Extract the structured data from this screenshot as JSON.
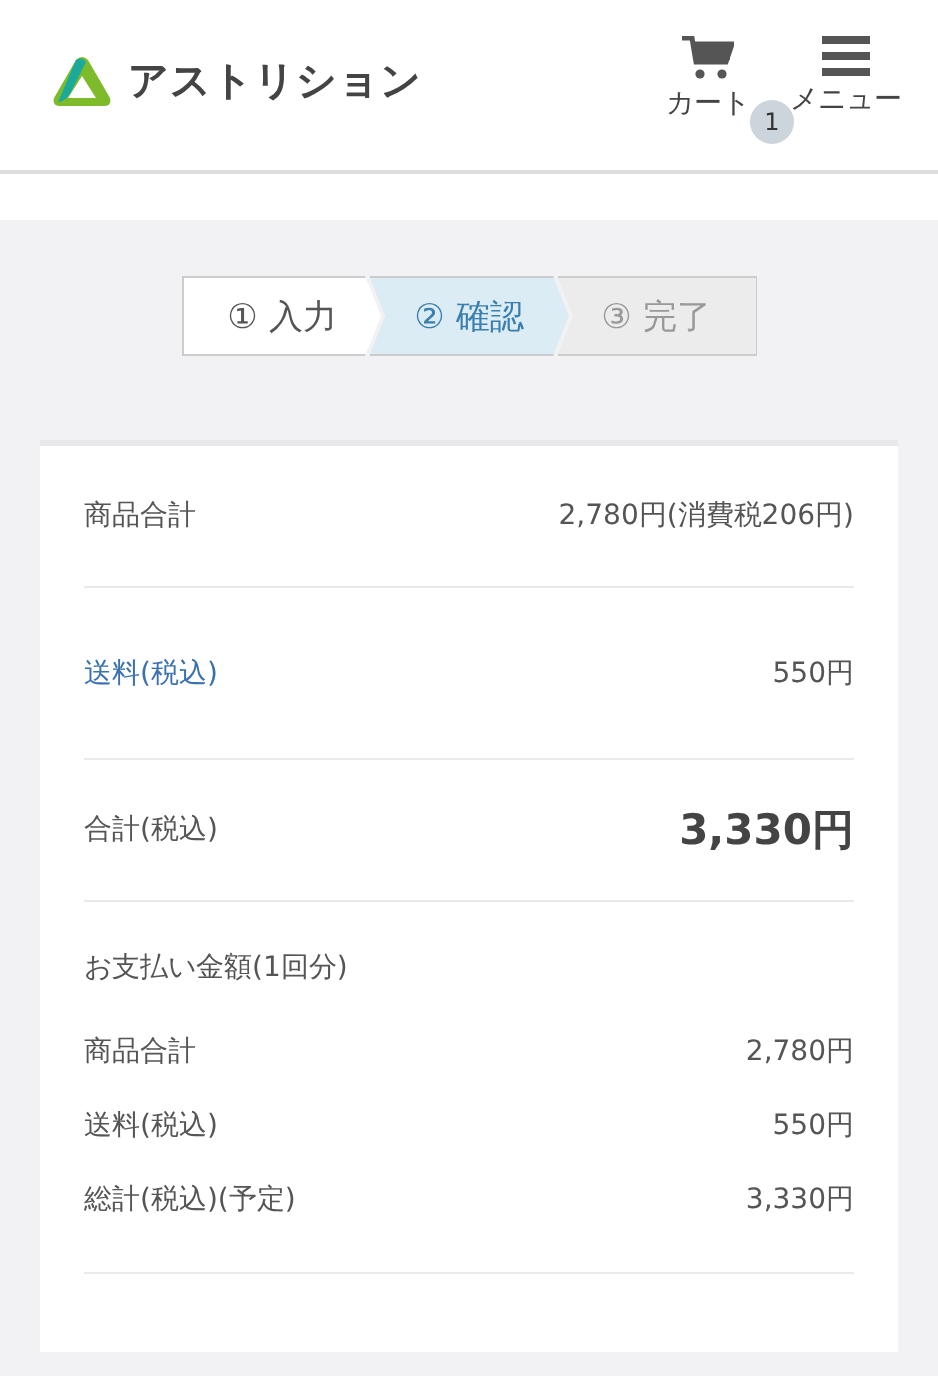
{
  "header": {
    "logo_text": "アストリション",
    "cart": {
      "label": "カート",
      "count": "1"
    },
    "menu": {
      "label": "メニュー"
    }
  },
  "steps": [
    {
      "label": "① 入力",
      "selected": false,
      "completed": true
    },
    {
      "label": "② 確認",
      "selected": true,
      "completed": false
    },
    {
      "label": "③ 完了",
      "selected": false,
      "completed": false
    }
  ],
  "summary": [
    {
      "label": "商品合計",
      "value": "2,780円(消費税206円)",
      "link": false,
      "emphasis": false
    },
    {
      "label": "送料(税込)",
      "value": "550円",
      "link": true,
      "emphasis": false
    },
    {
      "label": "合計(税込)",
      "value": "3,330円",
      "link": false,
      "emphasis": true
    }
  ],
  "payment": {
    "title": "お支払い金額(1回分)",
    "rows": [
      {
        "label": "商品合計",
        "value": "2,780円"
      },
      {
        "label": "送料(税込)",
        "value": "550円"
      },
      {
        "label": "総計(税込)(予定)",
        "value": "3,330円"
      }
    ]
  }
}
